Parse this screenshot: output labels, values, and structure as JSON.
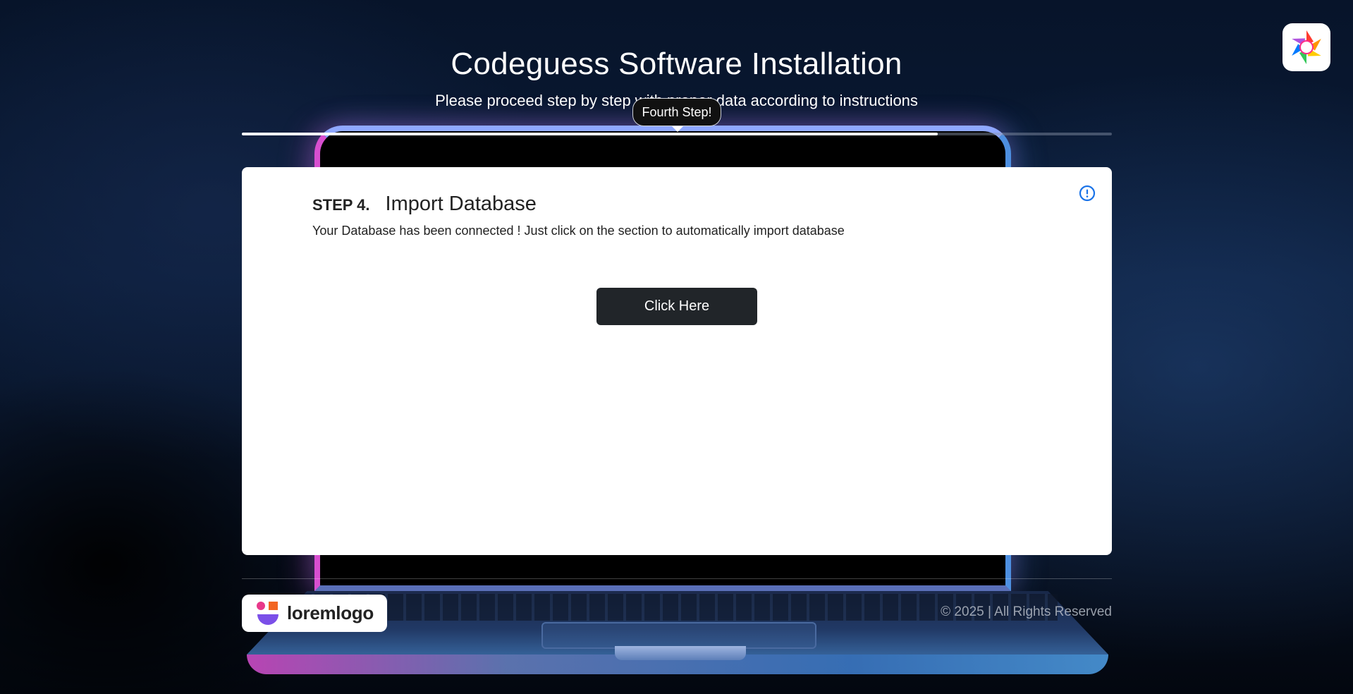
{
  "header": {
    "title": "Codeguess Software Installation",
    "subtitle": "Please proceed step by step with proper data according to instructions"
  },
  "progress": {
    "tooltip": "Fourth Step!",
    "fraction": 0.8
  },
  "step": {
    "number": "STEP 4.",
    "title": "Import Database",
    "description": "Your Database has been connected ! Just click on the section to automatically import database",
    "button_label": "Click Here"
  },
  "footer": {
    "logo_text": "loremlogo",
    "copyright": "© 2025 | All Rights Reserved"
  },
  "icons": {
    "brand": "brand-logo-icon",
    "info": "info-icon",
    "footer_logo": "loremlogo-icon"
  },
  "colors": {
    "progress_fill": "#ffffff",
    "button_bg": "#212529",
    "info_icon": "#1a73e8"
  }
}
